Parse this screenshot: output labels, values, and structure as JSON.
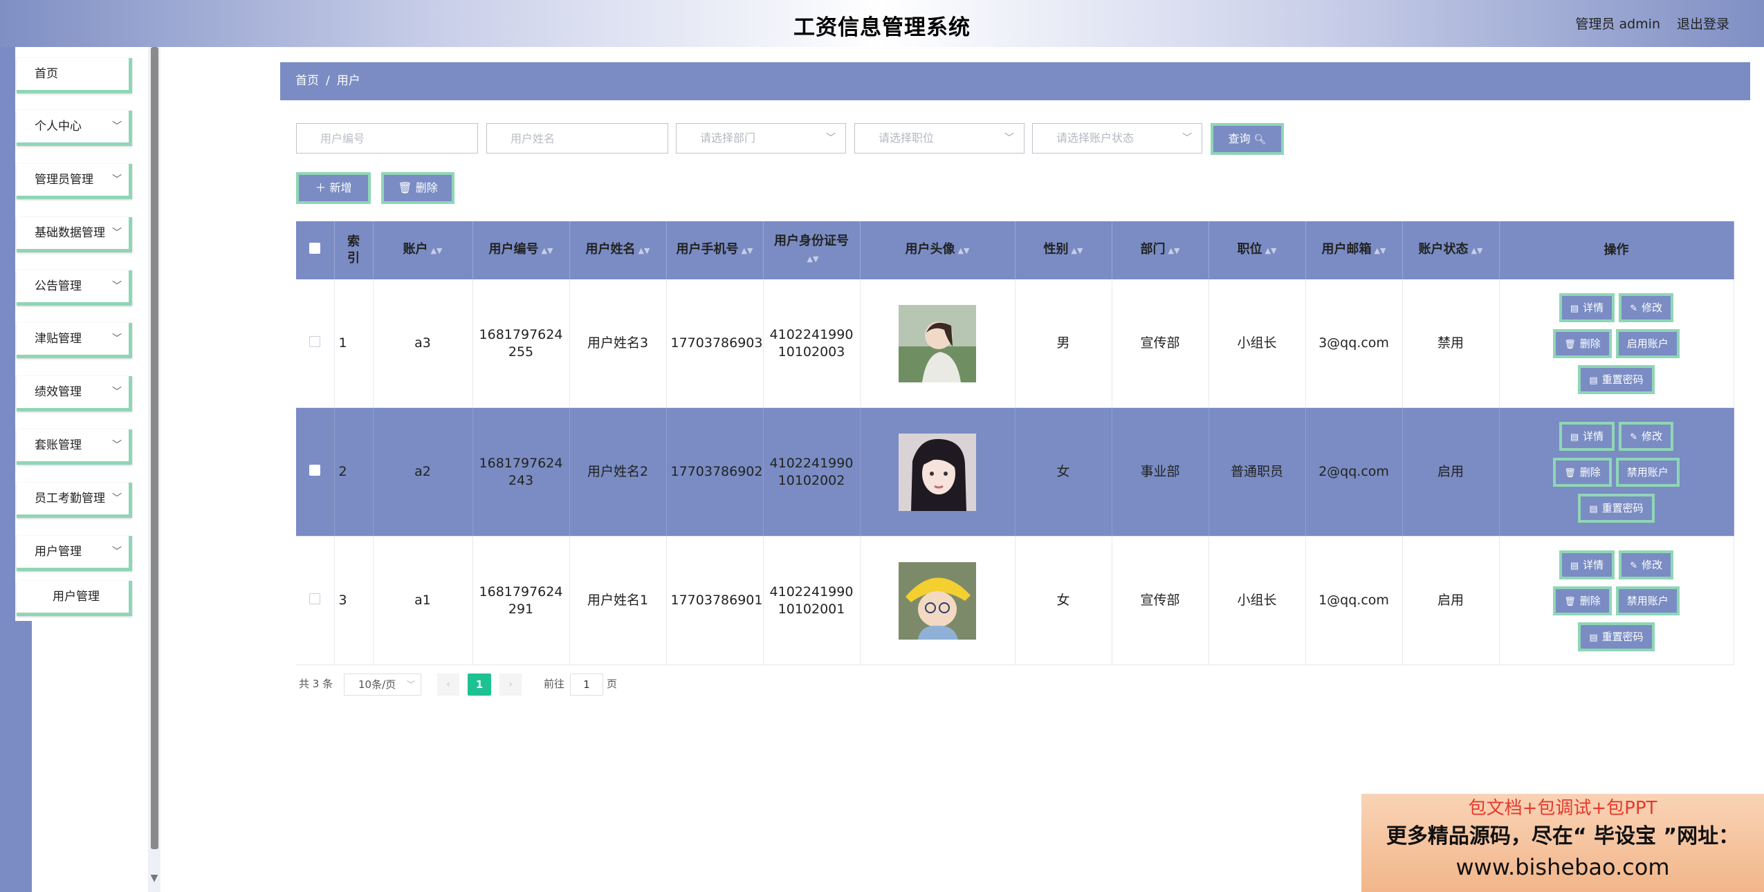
{
  "header": {
    "title": "工资信息管理系统",
    "user": "管理员 admin",
    "logout": "退出登录"
  },
  "sidebar": {
    "items": [
      {
        "label": "首页",
        "has_arrow": false
      },
      {
        "label": "个人中心",
        "has_arrow": true
      },
      {
        "label": "管理员管理",
        "has_arrow": true
      },
      {
        "label": "基础数据管理",
        "has_arrow": true
      },
      {
        "label": "公告管理",
        "has_arrow": true
      },
      {
        "label": "津贴管理",
        "has_arrow": true
      },
      {
        "label": "绩效管理",
        "has_arrow": true
      },
      {
        "label": "套账管理",
        "has_arrow": true
      },
      {
        "label": "员工考勤管理",
        "has_arrow": true
      },
      {
        "label": "用户管理",
        "has_arrow": true
      }
    ],
    "sub_item": "用户管理"
  },
  "breadcrumb": {
    "home": "首页",
    "sep": "/",
    "current": "用户"
  },
  "search": {
    "user_no_placeholder": "用户编号",
    "user_name_placeholder": "用户姓名",
    "dept_placeholder": "请选择部门",
    "position_placeholder": "请选择职位",
    "status_placeholder": "请选择账户状态",
    "query_label": "查询"
  },
  "actions": {
    "add_label": "新增",
    "delete_label": "删除"
  },
  "table": {
    "headers": {
      "index": "索引",
      "account": "账户",
      "user_no": "用户编号",
      "user_name": "用户姓名",
      "phone": "用户手机号",
      "id_card": "用户身份证号",
      "avatar": "用户头像",
      "gender": "性别",
      "dept": "部门",
      "position": "职位",
      "email": "用户邮箱",
      "status": "账户状态",
      "ops": "操作"
    },
    "rows": [
      {
        "index": "1",
        "account": "a3",
        "user_no": "1681797624255",
        "user_name": "用户姓名3",
        "phone": "17703786903",
        "id_card": "410224199010102003",
        "gender": "男",
        "dept": "宣传部",
        "position": "小组长",
        "email": "3@qq.com",
        "status": "禁用",
        "toggle": "启用账户"
      },
      {
        "index": "2",
        "account": "a2",
        "user_no": "1681797624243",
        "user_name": "用户姓名2",
        "phone": "17703786902",
        "id_card": "410224199010102002",
        "gender": "女",
        "dept": "事业部",
        "position": "普通职员",
        "email": "2@qq.com",
        "status": "启用",
        "toggle": "禁用账户"
      },
      {
        "index": "3",
        "account": "a1",
        "user_no": "1681797624291",
        "user_name": "用户姓名1",
        "phone": "17703786901",
        "id_card": "410224199010102001",
        "gender": "女",
        "dept": "宣传部",
        "position": "小组长",
        "email": "1@qq.com",
        "status": "启用",
        "toggle": "禁用账户"
      }
    ],
    "op_labels": {
      "detail": "详情",
      "edit": "修改",
      "delete": "删除",
      "reset": "重置密码"
    }
  },
  "pagination": {
    "total": "共 3 条",
    "page_size": "10条/页",
    "current": "1",
    "goto": "前往",
    "goto_value": "1",
    "page_unit": "页"
  },
  "promo": {
    "line1": "包文档+包调试+包PPT",
    "line2": "更多精品源码，尽在“ 毕设宝 ”网址：",
    "line3": "www.bishebao.com"
  },
  "colors": {
    "accent": "#7a8cc3",
    "border_accent": "#8fd6b6",
    "page_active": "#1ec192"
  }
}
